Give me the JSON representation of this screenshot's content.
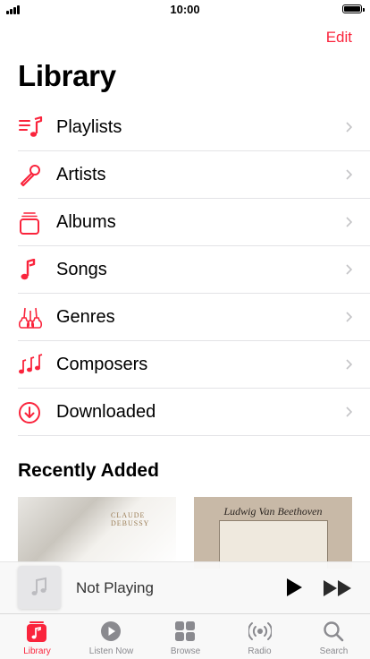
{
  "status_bar": {
    "time": "10:00"
  },
  "header": {
    "edit_label": "Edit",
    "title": "Library"
  },
  "library_items": [
    {
      "label": "Playlists",
      "icon": "playlists-icon"
    },
    {
      "label": "Artists",
      "icon": "microphone-icon"
    },
    {
      "label": "Albums",
      "icon": "albums-icon"
    },
    {
      "label": "Songs",
      "icon": "music-note-icon"
    },
    {
      "label": "Genres",
      "icon": "guitars-icon"
    },
    {
      "label": "Composers",
      "icon": "music-notes-icon"
    },
    {
      "label": "Downloaded",
      "icon": "download-circle-icon"
    }
  ],
  "recently_added": {
    "heading": "Recently Added",
    "albums": [
      {
        "cover_text": "CLAUDE DEBUSSY"
      },
      {
        "cover_text": "Ludwig Van Beethoven"
      }
    ]
  },
  "mini_player": {
    "status": "Not Playing"
  },
  "tab_bar": {
    "tabs": [
      {
        "label": "Library",
        "icon": "library-icon",
        "active": true
      },
      {
        "label": "Listen Now",
        "icon": "play-circle-icon",
        "active": false
      },
      {
        "label": "Browse",
        "icon": "grid-icon",
        "active": false
      },
      {
        "label": "Radio",
        "icon": "radio-icon",
        "active": false
      },
      {
        "label": "Search",
        "icon": "search-icon",
        "active": false
      }
    ]
  },
  "colors": {
    "accent": "#fa243c",
    "separator": "#e3e3e6",
    "inactive_tab": "#8a8a8f"
  }
}
